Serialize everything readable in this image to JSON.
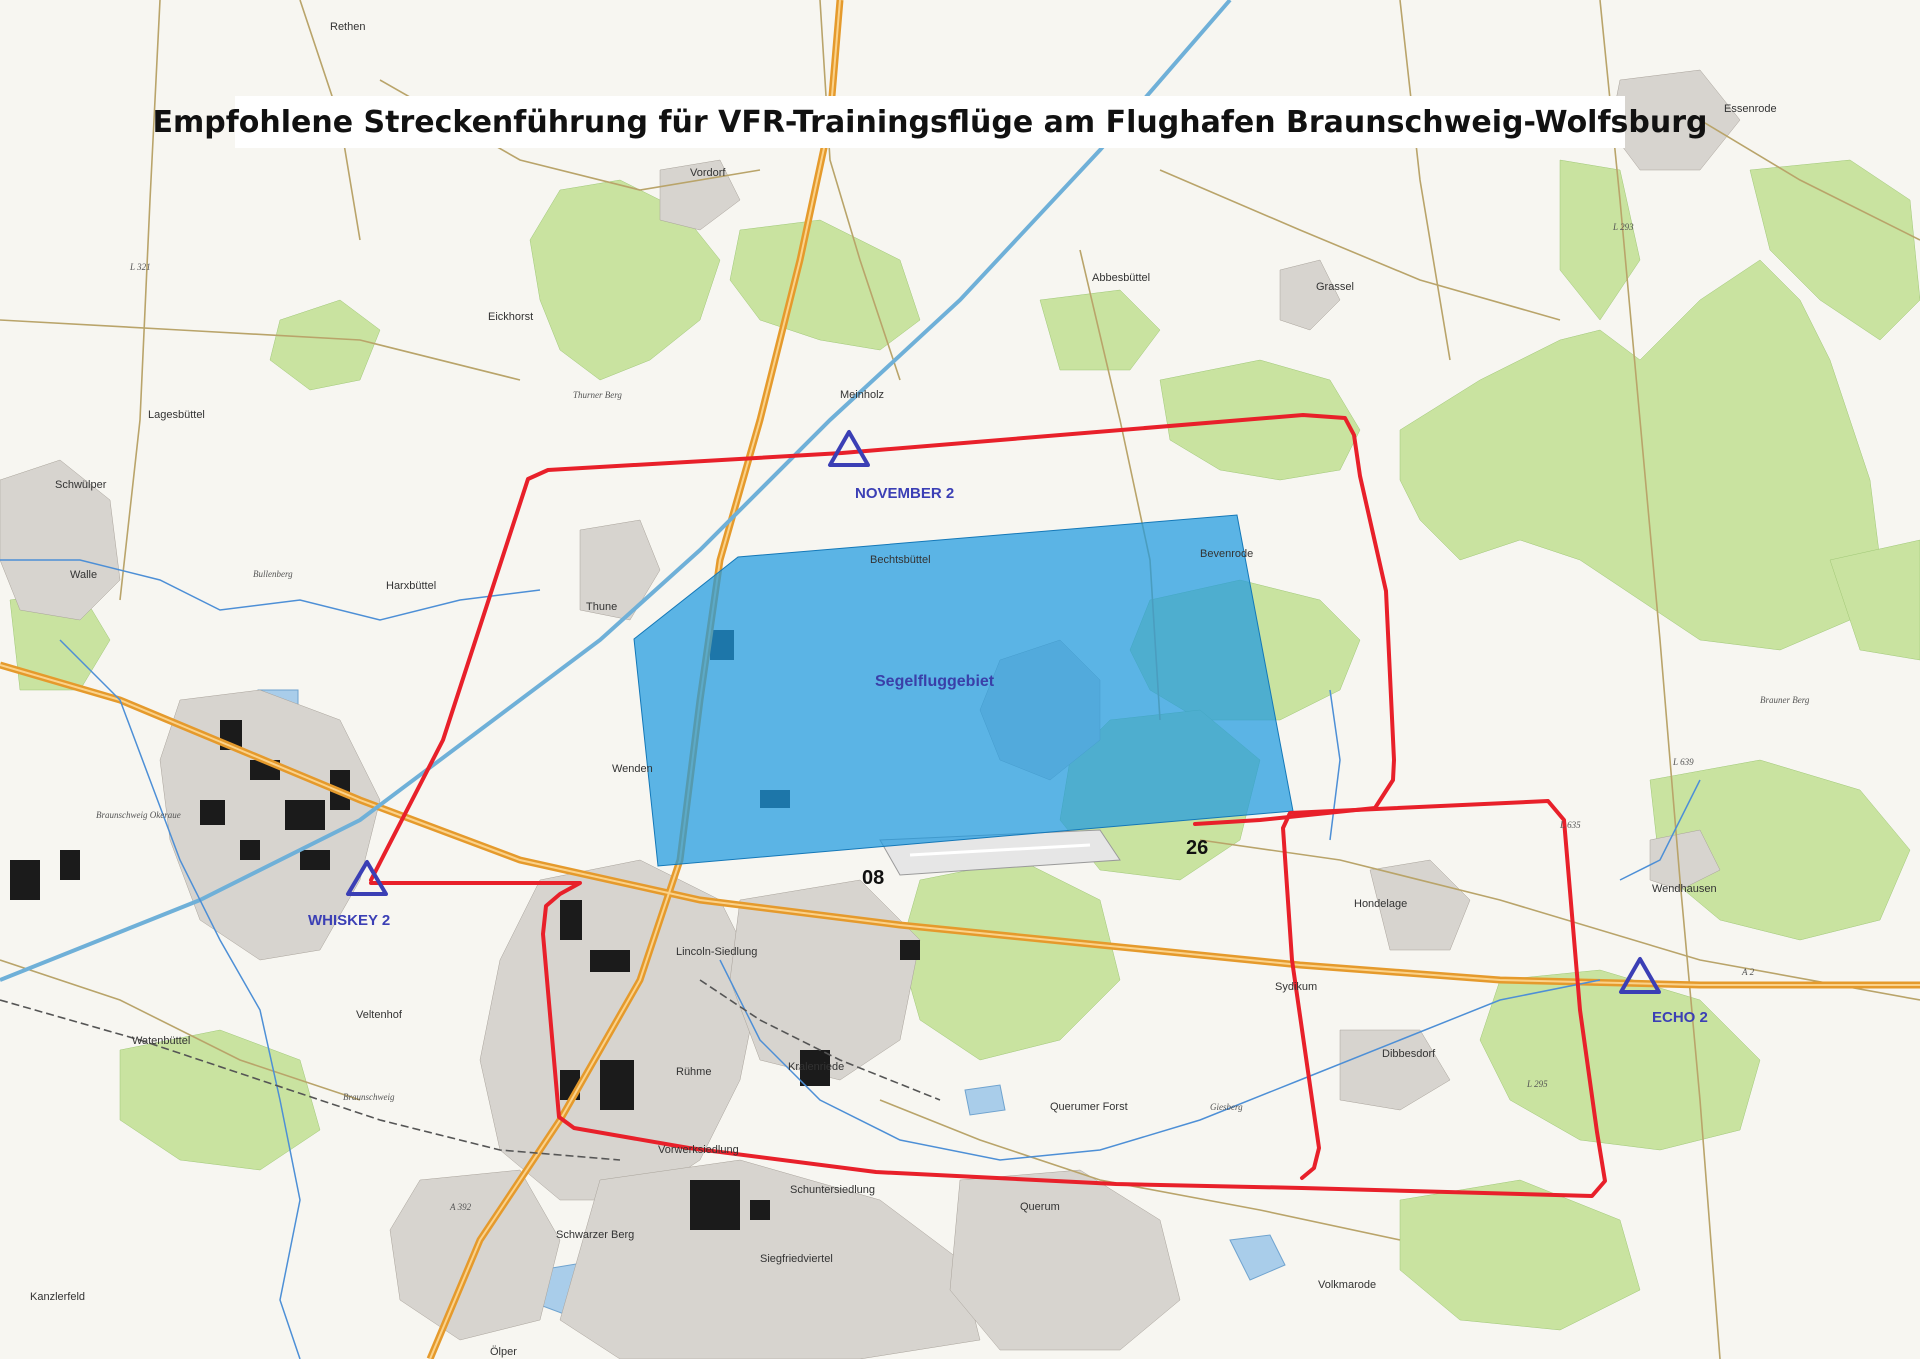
{
  "title": "Empfohlene Streckenführung für VFR-Trainingsflüge am Flughafen Braunschweig-Wolfsburg",
  "colors": {
    "route": "#e8202a",
    "glider_area": "#1e9ae0",
    "waypoint": "#3b3fb5",
    "forest": "#c9e3a0",
    "motorway": "#f0a030"
  },
  "waypoints": [
    {
      "id": "november",
      "label": "NOVEMBER 2",
      "icon": "triangle-icon"
    },
    {
      "id": "whiskey",
      "label": "WHISKEY 2",
      "icon": "triangle-icon"
    },
    {
      "id": "echo",
      "label": "ECHO 2",
      "icon": "triangle-icon"
    }
  ],
  "glider_area_label": "Segelfluggebiet",
  "runway": {
    "west_label": "08",
    "east_label": "26"
  },
  "places": [
    "Essenrode",
    "Abbesbüttel",
    "Grassel",
    "Eickhorst",
    "Meinholz",
    "Lagesbüttel",
    "Schwülper",
    "Harxbüttel",
    "Thune",
    "Bechtsbüttel",
    "Bevenrode",
    "Wenden",
    "Hondelage",
    "Wendhausen",
    "Dibbesdorf",
    "Querum",
    "Rühme",
    "Kralenriede",
    "Vorwerksiedlung",
    "Schwarzer Berg",
    "Veltenhof",
    "Watenbüttel",
    "Volkmarode",
    "Lincoln-Siedlung",
    "Sydikum",
    "Schuntersiedlung",
    "Walle",
    "Rethen",
    "Vordorf",
    "Kanzlerfeld",
    "Querumer Forst",
    "Siegfriedviertel",
    "Ölper"
  ],
  "small_labels": [
    "Thurner Berg",
    "Bullenberg",
    "Brauner Berg",
    "Braunschweig Okeraue",
    "Giesberg",
    "Braunschweig"
  ],
  "road_labels": [
    "A 2",
    "A 392",
    "L 295",
    "L 635",
    "L 639",
    "L 293",
    "L 321"
  ]
}
